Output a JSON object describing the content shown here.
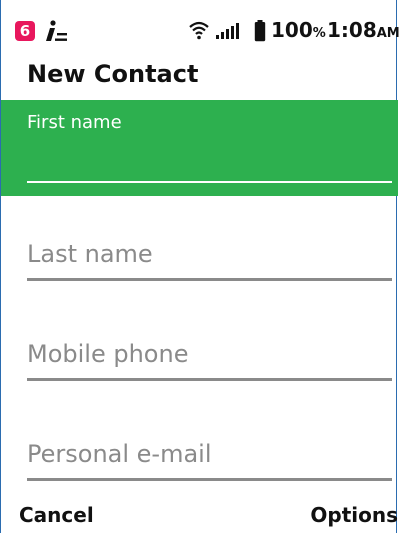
{
  "status_bar": {
    "notification_count": "6",
    "battery_percent": "100",
    "battery_unit": "%",
    "time": "1:08",
    "ampm": "AM",
    "icons": [
      "notification-badge",
      "info-icon",
      "wifi-icon",
      "signal-icon",
      "battery-icon"
    ]
  },
  "header": {
    "title": "New Contact"
  },
  "form": {
    "first_name_label": "First name",
    "last_name_placeholder": "Last name",
    "mobile_phone_placeholder": "Mobile phone",
    "personal_email_placeholder": "Personal e-mail"
  },
  "softkeys": {
    "left": "Cancel",
    "right": "Options"
  },
  "colors": {
    "accent": "#2db04f",
    "badge": "#e8175d",
    "placeholder": "#8a8a8a"
  }
}
